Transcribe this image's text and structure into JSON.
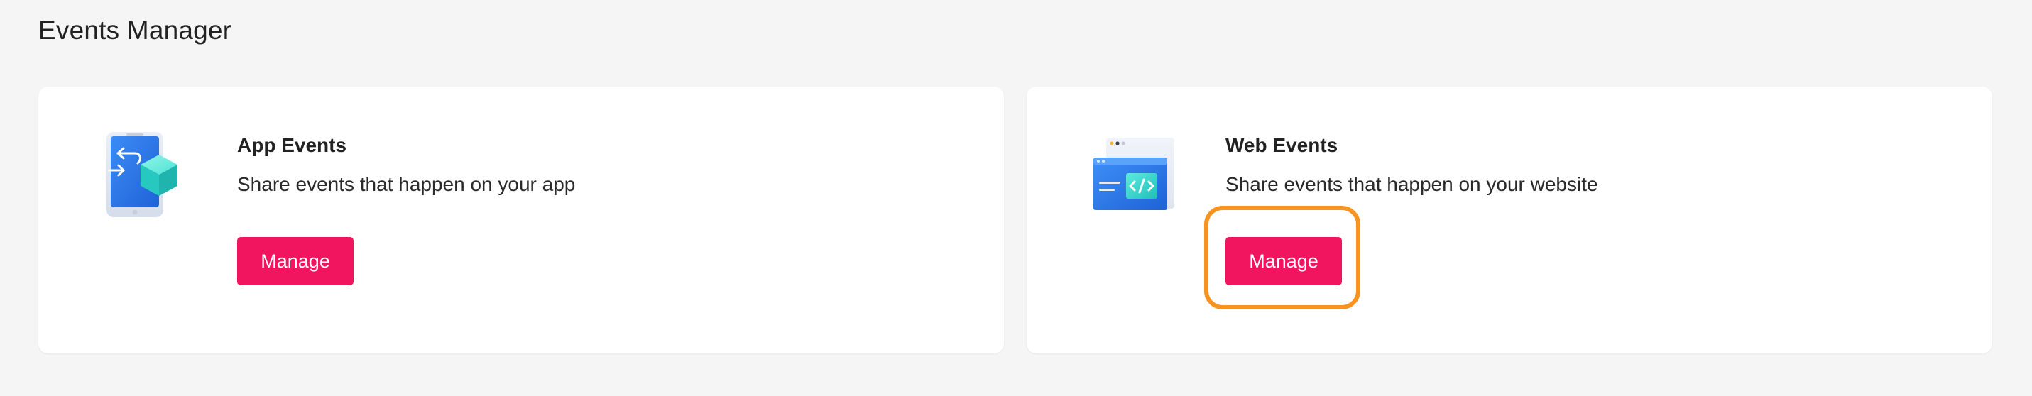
{
  "page": {
    "title": "Events Manager"
  },
  "cards": [
    {
      "title": "App Events",
      "description": "Share events that happen on your app",
      "button_label": "Manage",
      "icon": "mobile-app-cube-icon"
    },
    {
      "title": "Web Events",
      "description": "Share events that happen on your website",
      "button_label": "Manage",
      "icon": "browser-code-icon"
    }
  ],
  "colors": {
    "background": "#f5f5f5",
    "card": "#ffffff",
    "button": "#f0155e",
    "highlight": "#f7931e",
    "icon_blue": "#2f7ff0",
    "icon_teal": "#2ad6d3"
  }
}
